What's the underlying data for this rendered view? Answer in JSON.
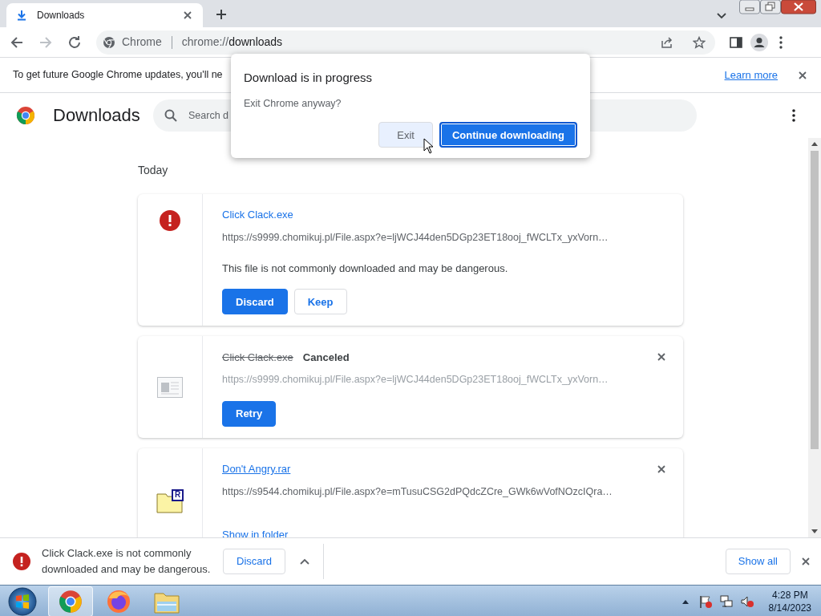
{
  "browser": {
    "tabs": [
      {
        "title": "Downloads",
        "selected": true
      }
    ],
    "nav": {
      "back_disabled": false,
      "forward_disabled": true
    },
    "omnibox": {
      "chip": "Chrome",
      "url_scheme": "chrome://",
      "url_path": "downloads"
    }
  },
  "infobar": {
    "text": "To get future Google Chrome updates, you'll ne",
    "link": "Learn more"
  },
  "page": {
    "title": "Downloads",
    "search": {
      "placeholder": "Search d"
    },
    "section": "Today",
    "downloads": [
      {
        "kind": "dangerous",
        "name": "Click Clack.exe",
        "url": "https://s9999.chomikuj.pl/File.aspx?e=ljWCJ44den5DGp23ET18ooj_fWCLTx_yxVorn…",
        "warning": "This file is not commonly downloaded and may be dangerous.",
        "actions": [
          {
            "label": "Discard",
            "kind": "primary"
          },
          {
            "label": "Keep",
            "kind": "secondary"
          }
        ]
      },
      {
        "kind": "canceled",
        "name": "Click Clack.exe",
        "status": "Canceled",
        "url": "https://s9999.chomikuj.pl/File.aspx?e=ljWCJ44den5DGp23ET18ooj_fWCLTx_yxVorn…",
        "actions": [
          {
            "label": "Retry",
            "kind": "primary"
          }
        ]
      },
      {
        "kind": "complete",
        "name": "Don't Angry.rar",
        "badge": "R",
        "url": "https://s9544.chomikuj.pl/File.aspx?e=mTusuCSG2dPQdcZCre_GWk6wVofNOzcIQra…",
        "link": "Show in folder"
      }
    ]
  },
  "shelf": {
    "message": "Click Clack.exe is not commonly downloaded and may be dangerous.",
    "discard": "Discard",
    "show_all": "Show all"
  },
  "taskbar": {
    "apps": [
      {
        "kind": "chrome",
        "selected": true
      },
      {
        "kind": "firefox",
        "selected": false
      },
      {
        "kind": "explorer",
        "selected": false
      }
    ],
    "time": "4:28 PM",
    "date": "8/14/2023"
  },
  "dialog": {
    "title": "Download is in progress",
    "message": "Exit Chrome anyway?",
    "buttons": [
      {
        "label": "Exit",
        "kind": "secondary"
      },
      {
        "label": "Continue downloading",
        "kind": "primary"
      }
    ]
  }
}
